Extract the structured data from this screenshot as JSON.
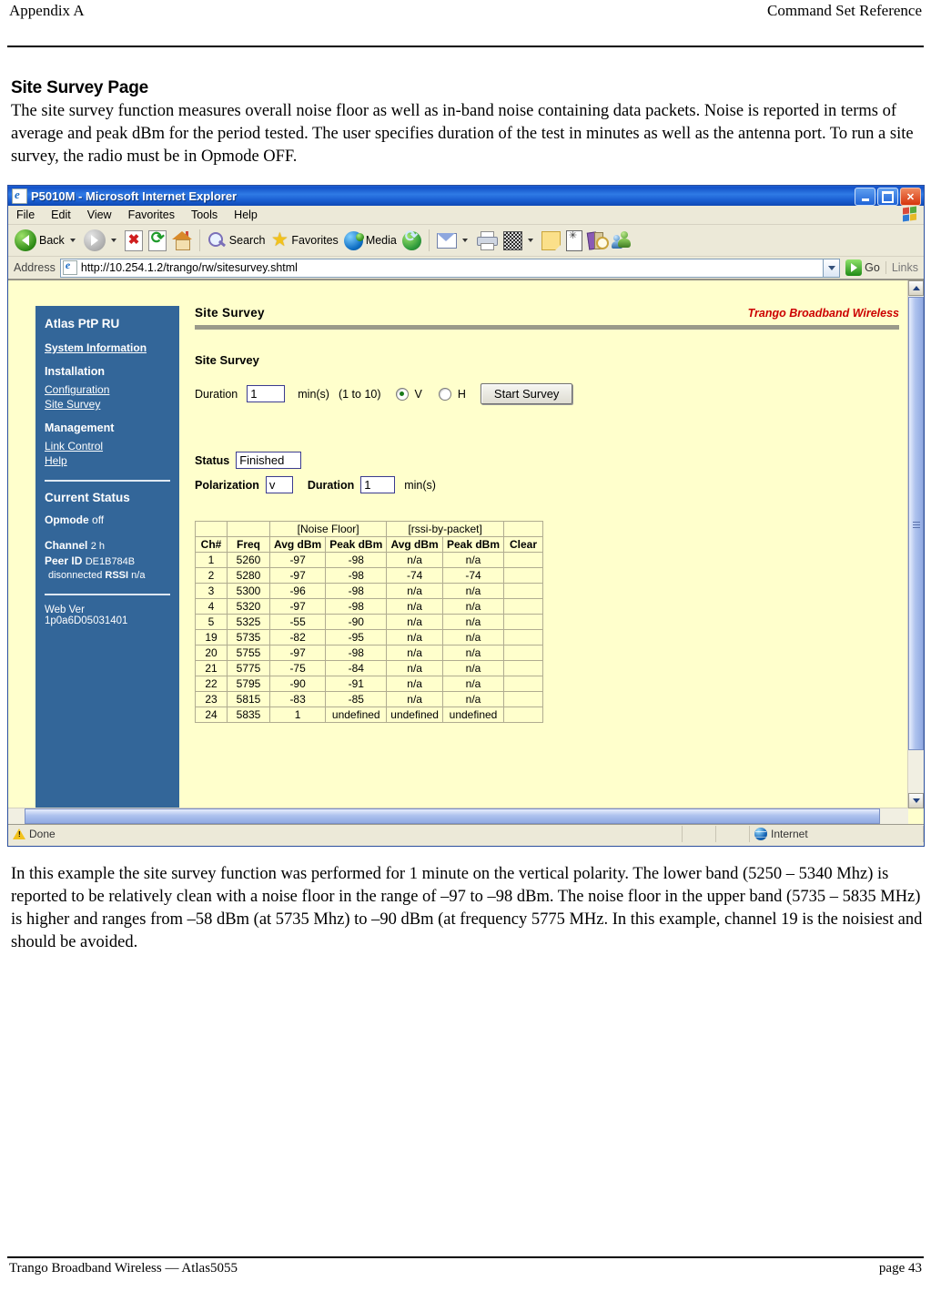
{
  "document": {
    "header_left": "Appendix A",
    "header_right": "Command Set Reference",
    "section_title": "Site Survey Page",
    "intro": "The site survey function measures overall noise floor as well as in-band noise containing data packets.  Noise is reported in terms of average and peak dBm for the period tested.  The user specifies duration of the test in minutes as well as the antenna port.  To run a site survey, the radio must be in Opmode OFF.",
    "outro": "In this example the site survey function was performed for 1 minute on the vertical polarity.  The lower band (5250 – 5340 Mhz) is reported to be relatively clean with a noise floor in the range of –97 to –98 dBm.  The noise floor in the upper band (5735 – 5835 MHz) is higher and ranges from –58 dBm (at 5735 Mhz) to –90 dBm (at frequency 5775 MHz.  In this example, channel 19 is the noisiest and should be avoided.",
    "footer_left": "Trango Broadband Wireless — Atlas5055",
    "footer_right": "page 43"
  },
  "browser": {
    "title": "P5010M - Microsoft Internet Explorer",
    "window_buttons": [
      "minimize",
      "restore",
      "close"
    ],
    "menu": [
      "File",
      "Edit",
      "View",
      "Favorites",
      "Tools",
      "Help"
    ],
    "toolbar": {
      "back_label": "Back",
      "search_label": "Search",
      "favorites_label": "Favorites",
      "media_label": "Media"
    },
    "address": {
      "label": "Address",
      "url": "http://10.254.1.2/trango/rw/sitesurvey.shtml",
      "go_label": "Go",
      "links_label": "Links"
    },
    "statusbar": {
      "status": "Done",
      "zone": "Internet"
    }
  },
  "nav": {
    "title": "Atlas PtP RU",
    "system_information": "System Information",
    "installation": "Installation",
    "configuration": "Configuration",
    "site_survey": "Site Survey",
    "management": "Management",
    "link_control": "Link Control",
    "help": "Help",
    "status_title": "Current Status",
    "opmode_label": "Opmode",
    "opmode_value": "off",
    "channel_label": "Channel",
    "channel_value": "2 h",
    "peerid_label": "Peer ID",
    "peerid_value": "DE1B784B",
    "conn_state": "disonnected",
    "rssi_label": "RSSI",
    "rssi_value": "n/a",
    "webver_label": "Web Ver",
    "webver_value": "1p0a6D05031401"
  },
  "page": {
    "heading": "Site Survey",
    "brand": "Trango Broadband Wireless",
    "section_heading": "Site Survey",
    "duration_label": "Duration",
    "duration_value": "1",
    "mins_label": "min(s)",
    "range_hint": "(1 to 10)",
    "pol_v": "V",
    "pol_h": "H",
    "start_button": "Start Survey",
    "status_label": "Status",
    "status_value": "Finished",
    "polarization_label": "Polarization",
    "polarization_value": "v",
    "result_duration_label": "Duration",
    "result_duration_value": "1",
    "result_mins_label": "min(s)"
  },
  "chart_data": {
    "type": "table",
    "title": "Site Survey Results",
    "group_headers": [
      "",
      "",
      "[Noise Floor]",
      "[rssi-by-packet]",
      ""
    ],
    "columns": [
      "Ch#",
      "Freq",
      "Avg dBm",
      "Peak dBm",
      "Avg dBm",
      "Peak dBm",
      "Clear"
    ],
    "rows": [
      [
        "1",
        "5260",
        "-97",
        "-98",
        "n/a",
        "n/a",
        ""
      ],
      [
        "2",
        "5280",
        "-97",
        "-98",
        "-74",
        "-74",
        ""
      ],
      [
        "3",
        "5300",
        "-96",
        "-98",
        "n/a",
        "n/a",
        ""
      ],
      [
        "4",
        "5320",
        "-97",
        "-98",
        "n/a",
        "n/a",
        ""
      ],
      [
        "5",
        "5325",
        "-55",
        "-90",
        "n/a",
        "n/a",
        ""
      ],
      [
        "19",
        "5735",
        "-82",
        "-95",
        "n/a",
        "n/a",
        ""
      ],
      [
        "20",
        "5755",
        "-97",
        "-98",
        "n/a",
        "n/a",
        ""
      ],
      [
        "21",
        "5775",
        "-75",
        "-84",
        "n/a",
        "n/a",
        ""
      ],
      [
        "22",
        "5795",
        "-90",
        "-91",
        "n/a",
        "n/a",
        ""
      ],
      [
        "23",
        "5815",
        "-83",
        "-85",
        "n/a",
        "n/a",
        ""
      ],
      [
        "24",
        "5835",
        "1",
        "undefined",
        "undefined",
        "undefined",
        ""
      ]
    ],
    "noise_floor_group": "[Noise Floor]",
    "rssi_group": "[rssi-by-packet]"
  },
  "colors": {
    "nav_bg": "#336699",
    "page_bg": "#ffffcc",
    "brand_red": "#cc0000",
    "titlebar_blue": "#1a5fd2"
  }
}
